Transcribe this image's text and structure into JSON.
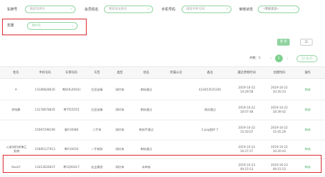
{
  "filters": {
    "plate_label": "车牌号",
    "plate_placeholder": "搜索车牌号",
    "member_label": "会员姓名",
    "member_placeholder": "搜索会员姓名",
    "phone_label": "手机号码",
    "phone_placeholder": "搜索手机号码",
    "review_label": "审核状态",
    "review_select": "--审核状态--",
    "branch_label": "支援",
    "branch_value": "网约车"
  },
  "actions": {
    "query_label": "查 询",
    "grid_icon": "grid-icon"
  },
  "pagination": {
    "total_text": "共数：5",
    "prev": "‹",
    "current": "1",
    "next": "›",
    "page_size": "10 条/页"
  },
  "table": {
    "columns": [
      "姓名",
      "手机号码",
      "车牌号码",
      "车型",
      "类型",
      "状态",
      "所属公司",
      "备注",
      "最近更新时间",
      "创建时间",
      "操作"
    ],
    "rows": [
      {
        "name": "A",
        "phone": "13189828635",
        "plate": "粤B(RL0916)",
        "model": "比亚迪秦",
        "type": "网约车",
        "status": "审核通过",
        "company": "",
        "remark": "433453535345",
        "updated": "2019-10-22 14:29:58",
        "created": "2019-10-22 10:20:23",
        "action": "审核"
      },
      {
        "name": "李铭静",
        "phone": "13178678835",
        "plate": "粤T555555",
        "model": "比亚迪秦",
        "type": "网约车",
        "status": "审核通过",
        "company": "",
        "remark": "测试通过",
        "updated": "2019-10-22 18:07:48",
        "created": "2019-10-22 18:39:42",
        "action": "审核"
      },
      {
        "name": "",
        "phone": "15087298196",
        "plate": "湘A10086",
        "model": "二手车",
        "type": "网约车",
        "status": "审核不通过",
        "company": "",
        "remark": "2.png图片了",
        "updated": "2019-10-22 15:50:07",
        "created": "2019-10-22 15:45:29",
        "action": "审核"
      },
      {
        "name": "心航网约前锋汇报商",
        "phone": "15685127913",
        "plate": "粤A10010",
        "model": "一手新款",
        "type": "网约车",
        "status": "审核通过",
        "company": "",
        "remark": "",
        "updated": "2019-10-22 16:27:27",
        "created": "2019-10-22 16:20:43",
        "action": "审核"
      },
      {
        "name": "HoozY",
        "phone": "13413626637",
        "plate": "粤1Q9S417",
        "model": "宏业豪途",
        "type": "网约车",
        "status": "未审核",
        "company": "",
        "remark": "",
        "updated": "2019-10-23 09:15:53",
        "created": "2019-10-23 09:15:53",
        "action": "审核"
      }
    ]
  },
  "colors": {
    "accent": "#7ed08f",
    "highlight": "#d9252a"
  }
}
